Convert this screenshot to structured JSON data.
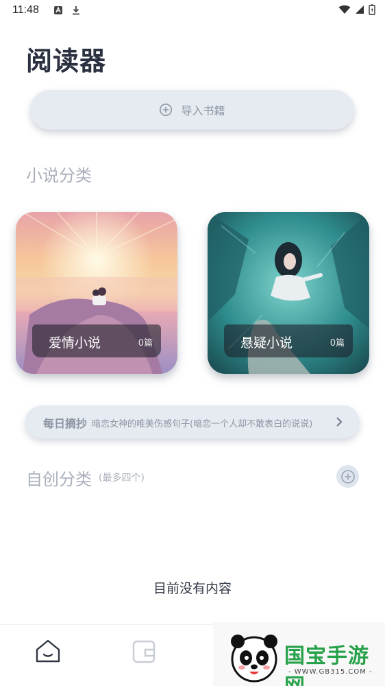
{
  "status_bar": {
    "time": "11:48"
  },
  "page_title": "阅读器",
  "import_button": {
    "label": "导入书籍"
  },
  "novel_section": {
    "title": "小说分类"
  },
  "categories": [
    {
      "name": "爱情小说",
      "count": "0篇"
    },
    {
      "name": "悬疑小说",
      "count": "0篇"
    }
  ],
  "daily_excerpt": {
    "label": "每日摘抄",
    "text": "暗恋女神的唯美伤感句子(暗恋一个人却不敢表白的说说)"
  },
  "custom_section": {
    "title": "自创分类",
    "subtitle": "(最多四个)"
  },
  "empty_message": "目前没有内容",
  "watermark": {
    "brand": "国宝手游网",
    "url": "- WWW.GB315.COM -"
  },
  "colors": {
    "accent_bg": "#e6eaf1",
    "muted_text": "#a9b0bb",
    "brand_green": "#27a24a"
  }
}
